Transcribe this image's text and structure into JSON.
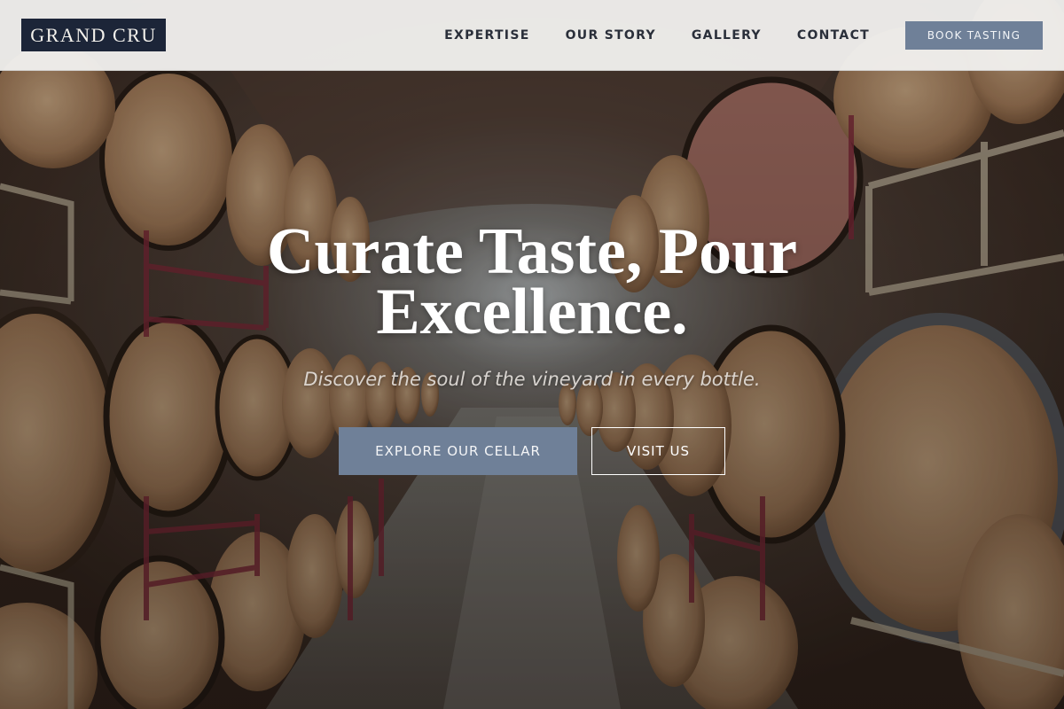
{
  "brand": {
    "name": "GRAND CRU"
  },
  "nav": {
    "links": [
      "EXPERTISE",
      "OUR STORY",
      "GALLERY",
      "CONTACT"
    ],
    "cta_label": "BOOK TASTING"
  },
  "hero": {
    "title": "Curate Taste, Pour Excellence.",
    "subtitle": "Discover the soul of the vineyard in every bottle.",
    "primary_button": "EXPLORE OUR CELLAR",
    "secondary_button": "VISIT US",
    "background": "wine-barrel-cellar-tunnel"
  },
  "colors": {
    "logo_bg": "#1c2538",
    "accent_button": "#6f8098",
    "header_bg": "#f0efed"
  }
}
